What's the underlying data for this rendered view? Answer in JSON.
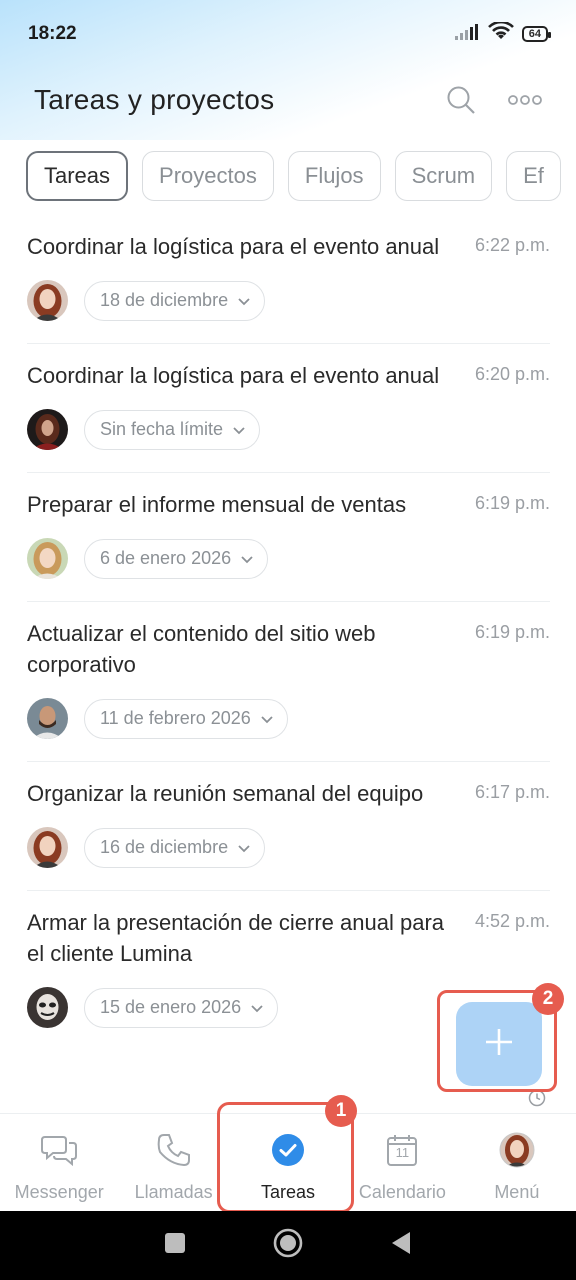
{
  "status_bar": {
    "time": "18:22",
    "battery": "64"
  },
  "header": {
    "title": "Tareas y proyectos"
  },
  "tabs": [
    {
      "label": "Tareas",
      "active": true
    },
    {
      "label": "Proyectos",
      "active": false
    },
    {
      "label": "Flujos",
      "active": false
    },
    {
      "label": "Scrum",
      "active": false
    },
    {
      "label": "Ef",
      "active": false
    }
  ],
  "tasks": [
    {
      "title": "Coordinar la logística para el evento anual",
      "time": "6:22 p.m.",
      "deadline": "18 de diciembre",
      "avatar": "avatar-woman-red"
    },
    {
      "title": "Coordinar la logística para el evento anual",
      "time": "6:20 p.m.",
      "deadline": "Sin fecha límite",
      "avatar": "avatar-dark"
    },
    {
      "title": "Preparar el informe mensual de ventas",
      "time": "6:19 p.m.",
      "deadline": "6 de enero 2026",
      "avatar": "avatar-woman-blonde"
    },
    {
      "title": "Actualizar el contenido del sitio web corporativo",
      "time": "6:19 p.m.",
      "deadline": "11 de febrero 2026",
      "avatar": "avatar-man-beard"
    },
    {
      "title": "Organizar la reunión semanal del equipo",
      "time": "6:17 p.m.",
      "deadline": "16 de diciembre",
      "avatar": "avatar-woman-red"
    },
    {
      "title": "Armar la presentación de cierre anual para el cliente Lumina",
      "time": "4:52 p.m.",
      "deadline": "15 de enero 2026",
      "avatar": "avatar-mask"
    }
  ],
  "annotations": {
    "badge_1": "1",
    "badge_2": "2"
  },
  "bottom_nav": [
    {
      "label": "Messenger",
      "icon": "chat-icon"
    },
    {
      "label": "Llamadas",
      "icon": "phone-icon"
    },
    {
      "label": "Tareas",
      "icon": "check-circle-icon",
      "active": true
    },
    {
      "label": "Calendario",
      "icon": "calendar-icon",
      "day": "11"
    },
    {
      "label": "Menú",
      "icon": "profile-avatar"
    }
  ],
  "colors": {
    "accent": "#2f8ce8",
    "fab": "#a9d1f6",
    "highlight": "#e65c4f"
  }
}
